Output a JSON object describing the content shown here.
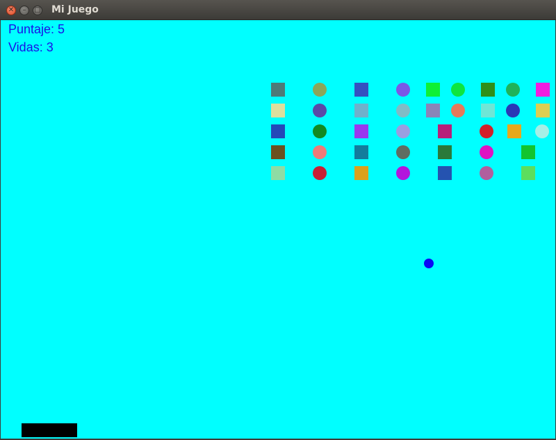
{
  "window": {
    "title": "Mi Juego"
  },
  "hud": {
    "score_text": "Puntaje: 5",
    "lives_text": "Vidas: 3"
  },
  "colors": {
    "background": "#00ffff",
    "ball": "#0a0af5",
    "paddle": "#000000",
    "hud_text": "#1a10e6"
  },
  "bricks": [
    {
      "row": 0,
      "col": 0,
      "shape": "square",
      "color": "#4d7b78"
    },
    {
      "row": 0,
      "col": 1,
      "shape": "circle",
      "color": "#8ba65a"
    },
    {
      "row": 0,
      "col": 2,
      "shape": "square",
      "color": "#3550c0"
    },
    {
      "row": 0,
      "col": 3,
      "shape": "circle",
      "color": "#7b58e6"
    },
    {
      "row": 0,
      "col": 4,
      "shape": "square",
      "color": "#0ef036"
    },
    {
      "row": 0,
      "col": 5,
      "shape": "circle",
      "color": "#0ee53f"
    },
    {
      "row": 0,
      "col": 6,
      "shape": "square",
      "color": "#2f8f1a"
    },
    {
      "row": 0,
      "col": 7,
      "shape": "circle",
      "color": "#1fb35a"
    },
    {
      "row": 0,
      "col": 8,
      "shape": "square",
      "color": "#f01ee0"
    },
    {
      "row": 1,
      "col": 0,
      "shape": "square",
      "color": "#dcdf9e"
    },
    {
      "row": 1,
      "col": 1,
      "shape": "circle",
      "color": "#5a4aa6"
    },
    {
      "row": 1,
      "col": 2,
      "shape": "square",
      "color": "#6fb1cb"
    },
    {
      "row": 1,
      "col": 3,
      "shape": "circle",
      "color": "#7fbcc6"
    },
    {
      "row": 1,
      "col": 4,
      "shape": "square",
      "color": "#8a84b8"
    },
    {
      "row": 1,
      "col": 5,
      "shape": "circle",
      "color": "#e6795a"
    },
    {
      "row": 1,
      "col": 6,
      "shape": "square",
      "color": "#6fe6d6"
    },
    {
      "row": 1,
      "col": 7,
      "shape": "circle",
      "color": "#2a38b6"
    },
    {
      "row": 1,
      "col": 8,
      "shape": "square",
      "color": "#dccf52"
    },
    {
      "row": 2,
      "col": 0,
      "shape": "square",
      "color": "#2449b8"
    },
    {
      "row": 2,
      "col": 1,
      "shape": "circle",
      "color": "#128a22"
    },
    {
      "row": 2,
      "col": 2,
      "shape": "square",
      "color": "#9a38ee"
    },
    {
      "row": 2,
      "col": 3,
      "shape": "circle",
      "color": "#9a9ee0"
    },
    {
      "row": 2,
      "col": 4,
      "shape": "square",
      "color": "#b71f7a"
    },
    {
      "row": 2,
      "col": 5,
      "shape": "circle",
      "color": "#d21f2a"
    },
    {
      "row": 2,
      "col": 6,
      "shape": "square",
      "color": "#e8a81c"
    },
    {
      "row": 2,
      "col": 7,
      "shape": "circle",
      "color": "#a5efe6"
    },
    {
      "row": 3,
      "col": 0,
      "shape": "square",
      "color": "#6b5120"
    },
    {
      "row": 3,
      "col": 1,
      "shape": "circle",
      "color": "#ee7b78"
    },
    {
      "row": 3,
      "col": 2,
      "shape": "square",
      "color": "#137c9c"
    },
    {
      "row": 3,
      "col": 3,
      "shape": "circle",
      "color": "#5f6d62"
    },
    {
      "row": 3,
      "col": 4,
      "shape": "square",
      "color": "#2a7a3a"
    },
    {
      "row": 3,
      "col": 5,
      "shape": "circle",
      "color": "#de12c2"
    },
    {
      "row": 3,
      "col": 6,
      "shape": "square",
      "color": "#12c42f"
    },
    {
      "row": 4,
      "col": 0,
      "shape": "square",
      "color": "#8edca4"
    },
    {
      "row": 4,
      "col": 1,
      "shape": "circle",
      "color": "#c81f34"
    },
    {
      "row": 4,
      "col": 2,
      "shape": "square",
      "color": "#dba11c"
    },
    {
      "row": 4,
      "col": 3,
      "shape": "circle",
      "color": "#b216dc"
    },
    {
      "row": 4,
      "col": 4,
      "shape": "square",
      "color": "#2553b0"
    },
    {
      "row": 4,
      "col": 5,
      "shape": "circle",
      "color": "#b05f9e"
    },
    {
      "row": 4,
      "col": 6,
      "shape": "square",
      "color": "#5cde5e"
    }
  ]
}
